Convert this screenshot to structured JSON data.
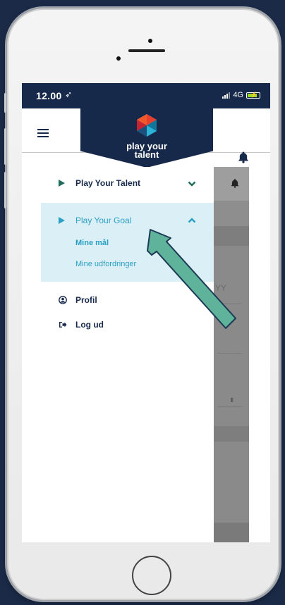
{
  "status_bar": {
    "time": "12.00",
    "location_icon": "location-arrow-icon",
    "network": "4G",
    "battery_color": "#9fdc2a"
  },
  "app_bar": {
    "logo_line1": "play your",
    "logo_line2": "talent",
    "brand_color": "#16294a"
  },
  "menu": {
    "items": [
      {
        "label": "Play Your Talent",
        "icon": "play-triangle-icon",
        "chevron": "chevron-down-icon"
      },
      {
        "label": "Play Your Goal",
        "icon": "play-triangle-icon",
        "chevron": "chevron-up-icon",
        "expanded": true,
        "children": [
          {
            "label": "Mine mål"
          },
          {
            "label": "Mine udfordringer"
          }
        ]
      },
      {
        "label": "Profil",
        "icon": "user-circle-icon"
      },
      {
        "label": "Log ud",
        "icon": "logout-icon"
      }
    ],
    "accent_color": "#2c9fc4",
    "expanded_bg": "#dbeff6"
  },
  "background_page": {
    "date_placeholder_fragment": "YY"
  },
  "annotation": {
    "arrow_color": "#5fb39a",
    "arrow_outline": "#1d3a55"
  }
}
